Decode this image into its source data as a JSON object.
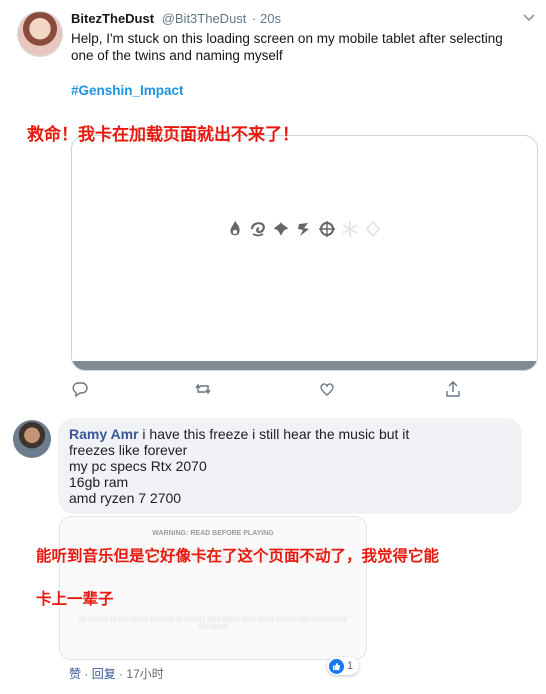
{
  "tweet": {
    "name": "BitezTheDust",
    "handle": "@Bit3TheDust",
    "time": "· 20s",
    "text": "Help, I'm stuck on this loading screen on my mobile tablet after selecting one of the twins and naming myself",
    "hashtag": "#Genshin_Impact",
    "actions": [
      "reply-icon",
      "retweet-icon",
      "like-icon",
      "share-icon"
    ]
  },
  "notes": {
    "note1": "救命！我卡在加载页面就出不来了！",
    "note2": "能听到音乐但是它好像卡在了这个页面不动了，我觉得它能",
    "note3": "卡上一辈子"
  },
  "comment": {
    "name": "Ramy Amr",
    "line1": "i have this freeze i still hear the music but it",
    "line2": "freezes like forever",
    "line3": "my pc specs Rtx 2070",
    "line4": "16gb ram",
    "line5": "amd ryzen 7 2700"
  },
  "attachment": {
    "title": "WARNING: READ BEFORE PLAYING"
  },
  "footer": {
    "like": "赞",
    "reply": "回复",
    "time": "17小时",
    "like_count": "1"
  }
}
